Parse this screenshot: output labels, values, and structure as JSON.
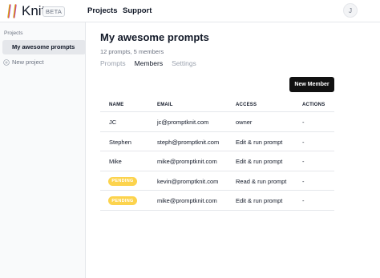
{
  "app": {
    "brand": "Knit",
    "badge": "BETA",
    "nav": [
      {
        "label": "Projects"
      },
      {
        "label": "Support"
      }
    ],
    "user_initial": "J"
  },
  "colors": {
    "logo_gradient": [
      "#22c55e",
      "#eab308",
      "#ef4444",
      "#8b5cf6",
      "#3b82f6"
    ],
    "primary_button": "#111111",
    "pending_badge": "#fcd34d"
  },
  "sidebar": {
    "heading": "Projects",
    "items": [
      {
        "label": "My awesome prompts",
        "selected": true
      }
    ],
    "new_project_label": "New project",
    "new_project_icon": "plus-circle-icon"
  },
  "main": {
    "title": "My awesome prompts",
    "subtitle": "12 prompts, 5 members",
    "tabs": [
      {
        "label": "Prompts",
        "active": false
      },
      {
        "label": "Members",
        "active": true
      },
      {
        "label": "Settings",
        "active": false
      }
    ],
    "new_member_label": "New Member"
  },
  "table": {
    "headers": {
      "name": "NAME",
      "email": "EMAIL",
      "access": "ACCESS",
      "actions": "ACTIONS"
    },
    "rows": [
      {
        "name": "JC",
        "pending": false,
        "email": "jc@promptknit.com",
        "access": "owner",
        "actions": "-"
      },
      {
        "name": "Stephen",
        "pending": false,
        "email": "steph@promptknit.com",
        "access": "Edit & run prompt",
        "actions": "-"
      },
      {
        "name": "Mike",
        "pending": false,
        "email": "mike@promptknit.com",
        "access": "Edit & run prompt",
        "actions": "-"
      },
      {
        "name": "PENDING",
        "pending": true,
        "email": "kevin@promptknit.com",
        "access": "Read & run prompt",
        "actions": "-"
      },
      {
        "name": "PENDING",
        "pending": true,
        "email": "mike@promptknit.com",
        "access": "Edit & run prompt",
        "actions": "-"
      }
    ]
  }
}
